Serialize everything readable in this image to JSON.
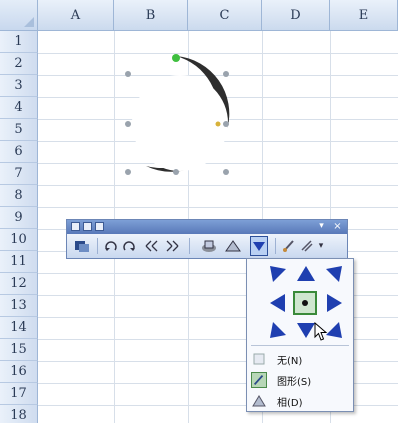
{
  "sheet": {
    "columns": [
      "A",
      "B",
      "C",
      "D",
      "E"
    ],
    "rows": [
      "1",
      "2",
      "3",
      "4",
      "5",
      "6",
      "7",
      "8",
      "9",
      "10",
      "11",
      "12",
      "13",
      "14",
      "15",
      "16",
      "17",
      "18"
    ]
  },
  "shape": {
    "type": "moon",
    "fill": "#2e2e2e",
    "handle_color": "#9aa3ad",
    "rotation_handle_color": "#3fbf3f"
  },
  "toolbar": {
    "close_glyph": "×",
    "pin_glyph": "▾",
    "buttons": [
      "",
      "",
      "",
      "",
      "",
      "",
      "",
      "",
      ""
    ]
  },
  "shadow_menu": {
    "arrow_color": "#1f3fb0",
    "items": [
      {
        "label": "无(N)",
        "selected": false
      },
      {
        "label": "图形(S)",
        "selected": true
      },
      {
        "label": "相(D)",
        "selected": false
      }
    ]
  },
  "colors": {
    "header_bg": "#dbe6f6",
    "grid": "#d7dfe9",
    "toolbar_title": "#5878b8"
  }
}
